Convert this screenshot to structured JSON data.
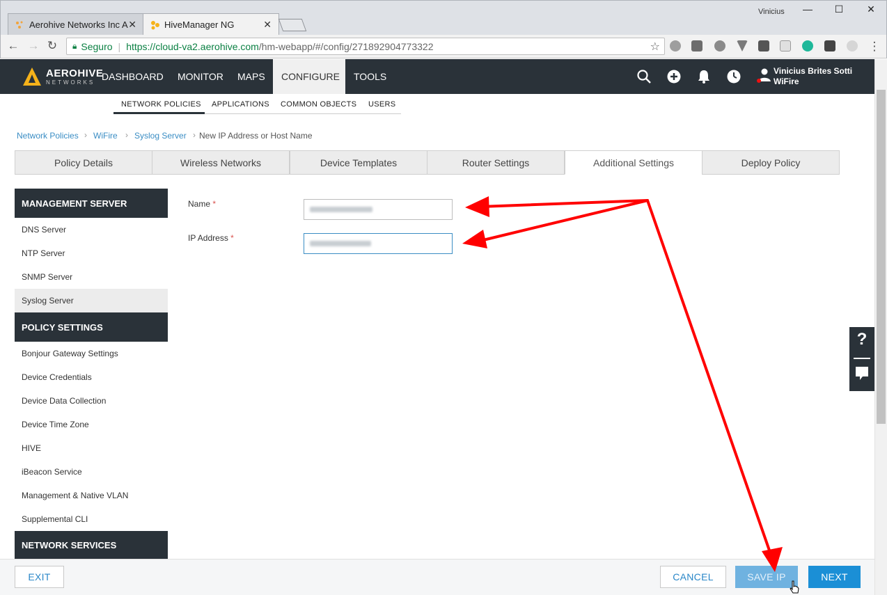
{
  "browser": {
    "window_user": "Vinicius",
    "tabs": [
      {
        "title": "Aerohive Networks Inc A",
        "active": false
      },
      {
        "title": "HiveManager NG",
        "active": true
      }
    ],
    "secure_label": "Seguro",
    "url_host": "https://cloud-va2.aerohive.com",
    "url_rest": "/hm-webapp/#/config/271892904773322",
    "minimize": "—",
    "maximize": "☐",
    "close": "✕"
  },
  "app": {
    "logo": {
      "name": "AEROHIVE",
      "sub": "NETWORKS"
    },
    "nav": [
      "DASHBOARD",
      "MONITOR",
      "MAPS",
      "CONFIGURE",
      "TOOLS"
    ],
    "active_nav": "CONFIGURE",
    "user": {
      "name": "Vinicius Brites Sotti",
      "org": "WiFire"
    },
    "subnav": [
      "NETWORK POLICIES",
      "APPLICATIONS",
      "COMMON OBJECTS",
      "USERS"
    ],
    "breadcrumb": [
      "Network Policies",
      "WiFire",
      "Syslog Server",
      "New IP Address or Host Name"
    ],
    "steps": [
      "Policy Details",
      "Wireless Networks",
      "Device Templates",
      "Router Settings",
      "Additional Settings",
      "Deploy Policy"
    ],
    "active_step": "Additional Settings"
  },
  "sidebar": {
    "sections": [
      {
        "title": "MANAGEMENT SERVER",
        "items": [
          "DNS Server",
          "NTP Server",
          "SNMP Server",
          "Syslog Server"
        ]
      },
      {
        "title": "POLICY SETTINGS",
        "items": [
          "Bonjour Gateway Settings",
          "Device Credentials",
          "Device Data Collection",
          "Device Time Zone",
          "HIVE",
          "iBeacon Service",
          "Management & Native VLAN",
          "Supplemental CLI"
        ]
      },
      {
        "title": "NETWORK SERVICES",
        "items": []
      }
    ],
    "active_item": "Syslog Server"
  },
  "form": {
    "name_label": "Name",
    "ip_label": "IP Address",
    "required_mark": "*"
  },
  "help": {
    "question": "?"
  },
  "footer": {
    "exit": "EXIT",
    "cancel": "CANCEL",
    "save": "SAVE IP",
    "next": "NEXT"
  },
  "colors": {
    "header_bg": "#2a3239",
    "accent": "#1b8fd6",
    "link": "#3a8dc4",
    "annotation": "#ff0000"
  }
}
